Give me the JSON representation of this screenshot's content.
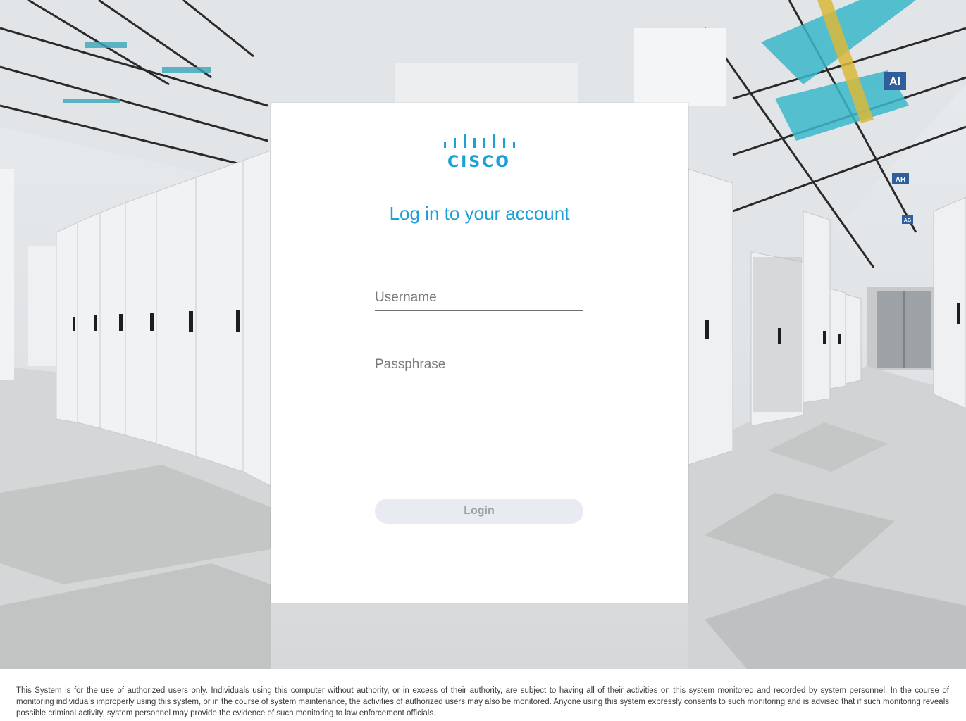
{
  "brand": {
    "logo_text": "CISCO",
    "color": "#1ba0d7"
  },
  "login_form": {
    "title": "Log in to your account",
    "username_placeholder": "Username",
    "passphrase_placeholder": "Passphrase",
    "login_label": "Login"
  },
  "footer": {
    "disclaimer": "This System is for the use of authorized users only. Individuals using this computer without authority, or in excess of their authority, are subject to having all of their activities on this system monitored and recorded by system personnel. In the course of monitoring individuals improperly using this system, or in the course of system maintenance, the activities of authorized users may also be monitored. Anyone using this system expressly consents to such monitoring and is advised that if such monitoring reveals possible criminal activity, system personnel may provide the evidence of such monitoring to law enforcement officials."
  },
  "background": {
    "signs": [
      "AI",
      "AH",
      "AG"
    ]
  }
}
